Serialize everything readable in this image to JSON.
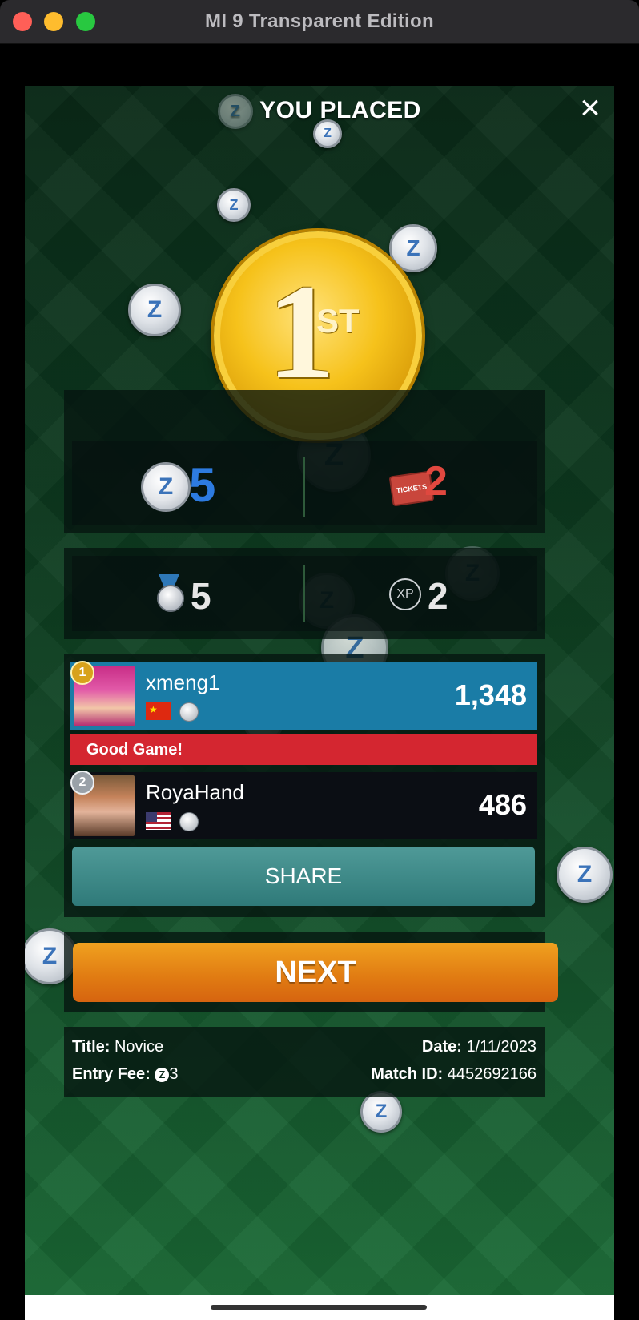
{
  "window": {
    "title": "MI 9 Transparent Edition"
  },
  "header": {
    "title": "YOU PLACED",
    "close_icon": "close-icon"
  },
  "placement": {
    "number": "1",
    "suffix": "ST"
  },
  "rewards": {
    "z_coins": "5",
    "tickets": "2"
  },
  "stats": {
    "medals": "5",
    "xp_label": "XP",
    "xp": "2"
  },
  "players": [
    {
      "rank": "1",
      "name": "xmeng1",
      "score": "1,348",
      "flag": "China",
      "color": "#1a7ca6"
    },
    {
      "rank": "2",
      "name": "RoyaHand",
      "score": "486",
      "flag": "USA",
      "color": "#0b0e14"
    }
  ],
  "message": "Good Game!",
  "buttons": {
    "share": "SHARE",
    "next": "NEXT"
  },
  "match_info": {
    "title_label": "Title:",
    "title_value": "Novice",
    "entry_label": "Entry Fee:",
    "entry_value": "3",
    "date_label": "Date:",
    "date_value": "1/11/2023",
    "match_label": "Match ID:",
    "match_value": "4452692166"
  },
  "coin_glyph": "Z"
}
